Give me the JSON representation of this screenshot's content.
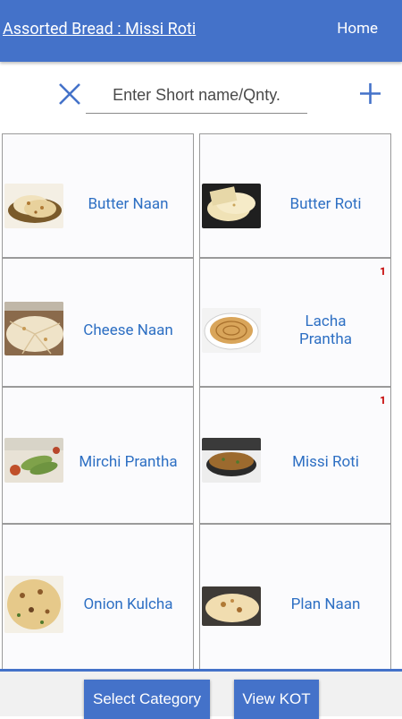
{
  "header": {
    "title": "Assorted Bread : Missi Roti",
    "home_label": "Home"
  },
  "search": {
    "placeholder": "Enter Short name/Qnty."
  },
  "items": [
    {
      "name": "Butter Naan",
      "count": ""
    },
    {
      "name": "Butter Roti",
      "count": ""
    },
    {
      "name": "Cheese Naan",
      "count": ""
    },
    {
      "name": "Lacha\nPrantha",
      "count": "1"
    },
    {
      "name": "Mirchi Prantha",
      "count": ""
    },
    {
      "name": "Missi Roti",
      "count": "1"
    },
    {
      "name": "Onion Kulcha",
      "count": ""
    },
    {
      "name": "Plan Naan",
      "count": ""
    }
  ],
  "footer": {
    "select_category_label": "Select Category",
    "view_kot_label": "View KOT"
  },
  "colors": {
    "accent": "#4472c9",
    "item_text": "#2d6fc3",
    "badge": "#c40000"
  }
}
